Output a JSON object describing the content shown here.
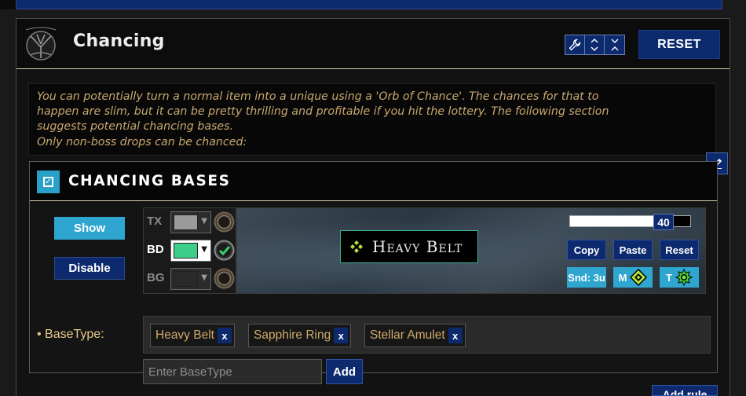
{
  "section": {
    "title": "Chancing",
    "reset_label": "RESET",
    "tools": [
      "wrench-icon",
      "expand-icon",
      "collapse-icon"
    ],
    "description": [
      "You can potentially turn a normal item into a unique using a 'Orb of Chance'. The chances for that to",
      "happen are slim, but it can be pretty thrilling and profitable if you hit the lottery. The following section",
      "suggests potential chancing bases.",
      "Only non-boss drops can be chanced:"
    ]
  },
  "rule": {
    "title": "CHANCING BASES",
    "enabled": true,
    "show_label": "Show",
    "disable_label": "Disable",
    "colors": [
      {
        "label": "TX",
        "active": false,
        "swatch": "#9a9a9a"
      },
      {
        "label": "BD",
        "active": true,
        "swatch": "#3ccf8a"
      },
      {
        "label": "BG",
        "active": false,
        "swatch": "#2a2a2a"
      }
    ],
    "preview": {
      "item_name": "Heavy Belt",
      "font_size": "40",
      "font_size_fraction": 0.78,
      "border_color": "#3cb493",
      "icon_color": "#b8e23a"
    },
    "actions": {
      "copy": "Copy",
      "paste": "Paste",
      "reset": "Reset",
      "sound": "Snd: 3u",
      "minimap": "M",
      "beam": "T"
    },
    "basetype_label": "BaseType:",
    "basetypes": [
      "Heavy Belt",
      "Sapphire Ring",
      "Stellar Amulet"
    ],
    "remove_label": "x",
    "input_placeholder": "Enter BaseType",
    "add_label": "Add"
  },
  "footer": {
    "add_rule_label": "Add rule"
  },
  "colors": {
    "navy": "#0d2a6e",
    "cyan": "#2fa6d0",
    "gold_text": "#c9a870",
    "tag_text": "#cfa96a"
  }
}
